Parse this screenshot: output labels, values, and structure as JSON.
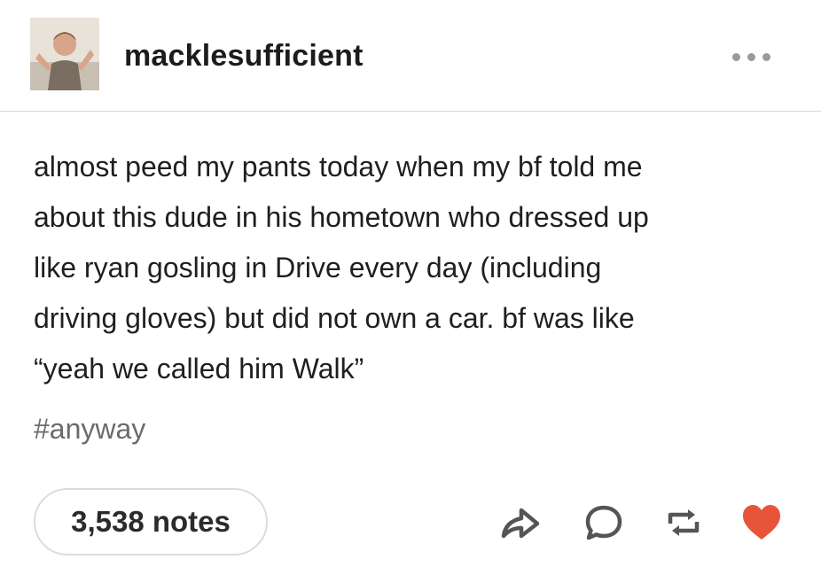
{
  "post": {
    "username": "macklesufficient",
    "body_lines": [
      "almost peed my pants today when my bf told me",
      "about this dude in his hometown who dressed up",
      "like ryan gosling in Drive every day (including",
      "driving gloves) but did not own a car. bf was like",
      "“yeah we called him Walk”"
    ],
    "tag": "#anyway",
    "notes_label": "3,538 notes"
  },
  "icons": {
    "more": "more-options-icon",
    "share": "share-icon",
    "reply": "reply-icon",
    "reblog": "reblog-icon",
    "like": "heart-icon"
  },
  "colors": {
    "like_heart": "#e8543a",
    "icon_gray": "#555555",
    "tag_gray": "#6b6b6b"
  }
}
